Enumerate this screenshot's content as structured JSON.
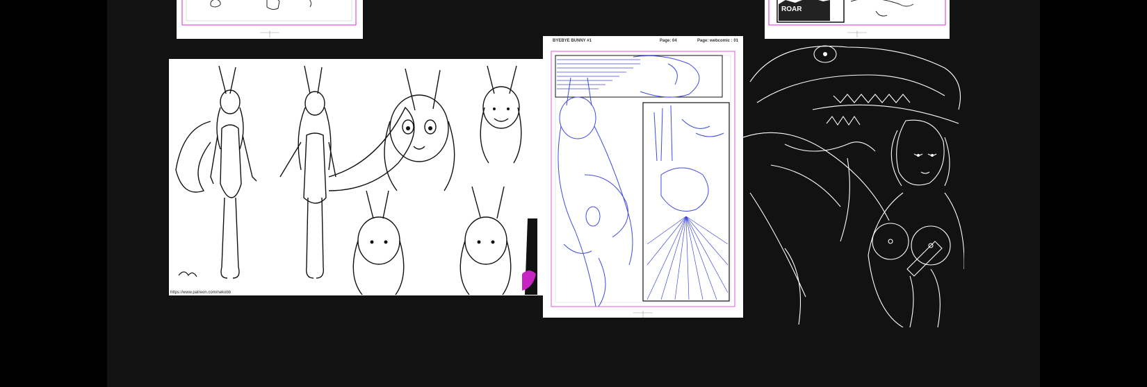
{
  "gallery": {
    "thumbnails": [
      {
        "id": "panel-sketch-top-left",
        "alt": ""
      },
      {
        "id": "panel-roar-top-right",
        "alt": ""
      },
      {
        "id": "character-sheet",
        "alt": "",
        "url_text": "https://www.patreon.com/nekobb"
      },
      {
        "id": "comic-page-04",
        "alt": ""
      },
      {
        "id": "dragon-lineart",
        "alt": ""
      }
    ],
    "comic_page": {
      "series": "BYEBYE BUNNY #1",
      "page": "Page: 04",
      "page_webcomic": "Page: webcomic :  01"
    },
    "roar_text": "ROAR"
  },
  "colors": {
    "background": "#000000",
    "panel": "#121212",
    "sketch_blue": "#3f49e0",
    "guide_magenta": "#e02bd8"
  }
}
